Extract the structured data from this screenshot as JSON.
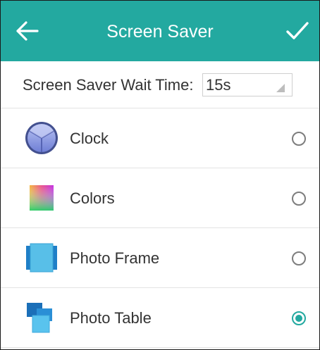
{
  "header": {
    "title": "Screen Saver",
    "back_icon": "arrow-left-icon",
    "confirm_icon": "checkmark-icon",
    "color": "#23a9a0"
  },
  "wait_time": {
    "label": "Screen Saver Wait Time:",
    "value": "15s"
  },
  "options": [
    {
      "label": "Clock",
      "icon": "clock-icon",
      "selected": false
    },
    {
      "label": "Colors",
      "icon": "colors-icon",
      "selected": false
    },
    {
      "label": "Photo Frame",
      "icon": "photo-frame-icon",
      "selected": false
    },
    {
      "label": "Photo Table",
      "icon": "photo-table-icon",
      "selected": true
    }
  ]
}
